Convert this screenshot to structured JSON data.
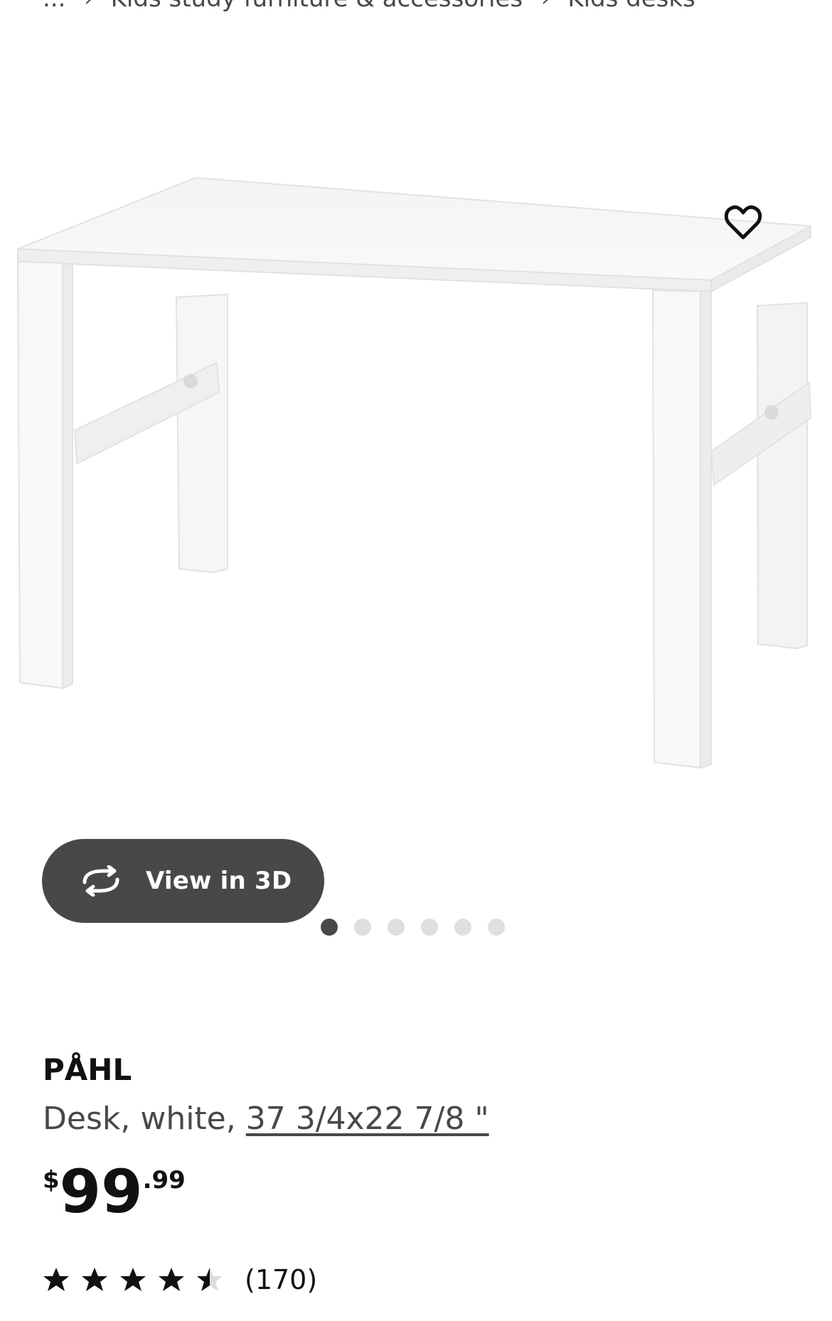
{
  "breadcrumb": {
    "items": [
      "...",
      "Kids study furniture & accessories",
      "Kids desks"
    ]
  },
  "gallery": {
    "view_3d_label": "View in 3D",
    "favorite_icon": "heart-outline-icon",
    "rotate_icon": "rotate-3d-icon",
    "dot_count": 6,
    "active_dot": 0
  },
  "product": {
    "name": "PÅHL",
    "description_prefix": "Desk, white, ",
    "dimensions": "37 3/4x22 7/8 \"",
    "price": {
      "currency": "$",
      "integer": "99",
      "decimal": ".99"
    },
    "rating": {
      "stars": 4.5,
      "review_count": "(170)"
    }
  },
  "colors": {
    "button_bg": "#484848",
    "text_dark": "#111111",
    "text_muted": "#484848",
    "dot_inactive": "#dfdfdf",
    "dot_active": "#484848"
  }
}
